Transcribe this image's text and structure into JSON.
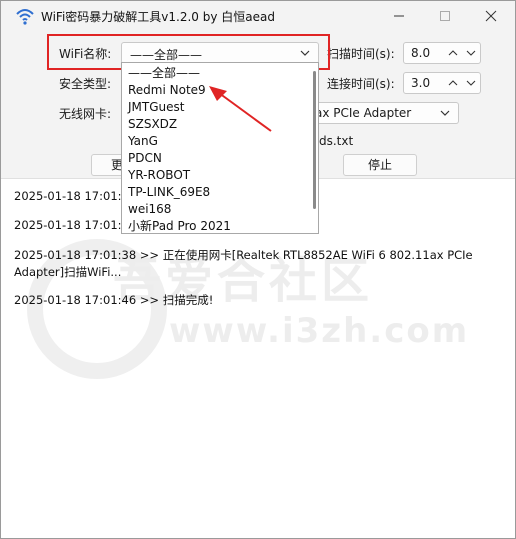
{
  "window": {
    "title": "WiFi密码暴力破解工具v1.2.0 by 白恒aead"
  },
  "form": {
    "wifi_name_label": "WiFi名称:",
    "wifi_name_value": "——全部——",
    "security_label": "安全类型:",
    "adapter_label": "无线网卡:",
    "adapter_value_visible": "ax PCIe Adapter",
    "dict_file_visible": "ds.txt",
    "scan_time_label": "扫描时间(s):",
    "scan_time_value": "8.0",
    "connect_time_label": "连接时间(s):",
    "connect_time_value": "3.0",
    "change_button_visible": "更换",
    "stop_button": "停止"
  },
  "dropdown": {
    "options": [
      "——全部——",
      "Redmi Note9",
      "JMTGuest",
      "SZSXDZ",
      "YanG",
      "PDCN",
      "YR-ROBOT",
      "TP-LINK_69E8",
      "wei168",
      "小新Pad Pro 2021"
    ]
  },
  "log": {
    "lines": [
      "2025-01-18 17:01:",
      "2025-01-18 17:01:",
      "2025-01-18 17:01:38 >> 正在使用网卡[Realtek RTL8852AE WiFi 6 802.11ax PCIe",
      "Adapter]扫描WiFi...",
      "2025-01-18 17:01:46 >> 扫描完成!"
    ]
  },
  "watermark": {
    "big_text": "吾爱合社区",
    "url": "www.i3zh.com"
  },
  "colors": {
    "highlight": "#e02424",
    "arrow": "#e02424",
    "window_bg": "#f3f3f3"
  }
}
